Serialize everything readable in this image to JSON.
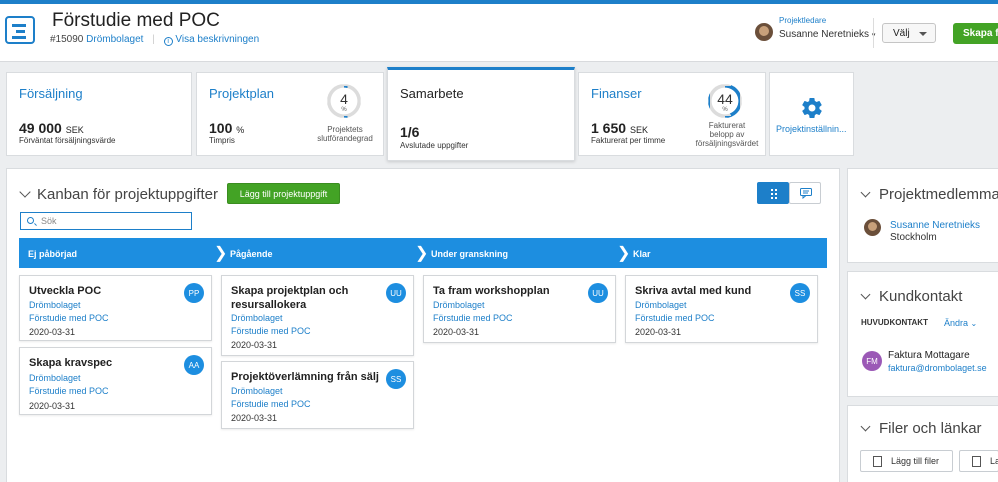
{
  "header": {
    "title": "Förstudie med POC",
    "project_number": "#15090",
    "client": "Drömbolaget",
    "description_link": "Visa beskrivningen",
    "leader_role": "Projektledare",
    "leader_name": "Susanne Neretnieks",
    "select_label": "Välj",
    "create_label": "Skapa fa"
  },
  "tiles": {
    "sales": {
      "name": "Försäljning",
      "value": "49 000",
      "unit": "SEK",
      "caption": "Förväntat försäljningsvärde"
    },
    "plan": {
      "name": "Projektplan",
      "value": "100",
      "unit": "%",
      "caption": "Timpris",
      "ring_value": "4",
      "ring_unit": "%",
      "ring_caption_1": "Projektets",
      "ring_caption_2": "slutförandegrad",
      "ring_fraction": 0.04
    },
    "collab": {
      "name": "Samarbete",
      "value": "1/6",
      "caption": "Avslutade uppgifter"
    },
    "finance": {
      "name": "Finanser",
      "value": "1 650",
      "unit": "SEK",
      "caption": "Fakturerat per timme",
      "ring_value": "44",
      "ring_unit": "%",
      "ring_caption_1": "Fakturerat",
      "ring_caption_2": "belopp av",
      "ring_caption_3": "försäljningsvärdet",
      "ring_fraction": 0.44
    },
    "settings": {
      "label": "Projektinställnin..."
    }
  },
  "kanban": {
    "title": "Kanban för projektuppgifter",
    "add_label": "Lägg till projektuppgift",
    "search_placeholder": "Sök",
    "columns": [
      "Ej påbörjad",
      "Pågående",
      "Under granskning",
      "Klar"
    ],
    "cards": [
      {
        "title": "Utveckla POC",
        "client": "Drömbolaget",
        "project": "Förstudie med POC",
        "date": "2020-03-31",
        "initials": "PP"
      },
      {
        "title": "Skapa kravspec",
        "client": "Drömbolaget",
        "project": "Förstudie med POC",
        "date": "2020-03-31",
        "initials": "AA"
      },
      {
        "title": "Skapa projektplan och resursallokera",
        "client": "Drömbolaget",
        "project": "Förstudie med POC",
        "date": "2020-03-31",
        "initials": "UU"
      },
      {
        "title": "Projektöverlämning från sälj",
        "client": "Drömbolaget",
        "project": "Förstudie med POC",
        "date": "2020-03-31",
        "initials": "SS"
      },
      {
        "title": "Ta fram workshopplan",
        "client": "Drömbolaget",
        "project": "Förstudie med POC",
        "date": "2020-03-31",
        "initials": "UU"
      },
      {
        "title": "Skriva avtal med kund",
        "client": "Drömbolaget",
        "project": "Förstudie med POC",
        "date": "2020-03-31",
        "initials": "SS"
      }
    ]
  },
  "members": {
    "title": "Projektmedlemma",
    "name": "Susanne Neretnieks",
    "location": "Stockholm"
  },
  "customer": {
    "title": "Kundkontakt",
    "main_label": "HUVUDKONTAKT",
    "change_label": "Ändra",
    "initials": "FM",
    "name": "Faktura Mottagare",
    "email": "faktura@drombolaget.se"
  },
  "files": {
    "title": "Filer och länkar",
    "add_files": "Lägg till filer",
    "add_link": "La"
  },
  "colors": {
    "accent": "#1d7fc9",
    "green": "#43a325",
    "column_bar": "#1d8ee0",
    "avatar_fm": "#9b59b6"
  }
}
